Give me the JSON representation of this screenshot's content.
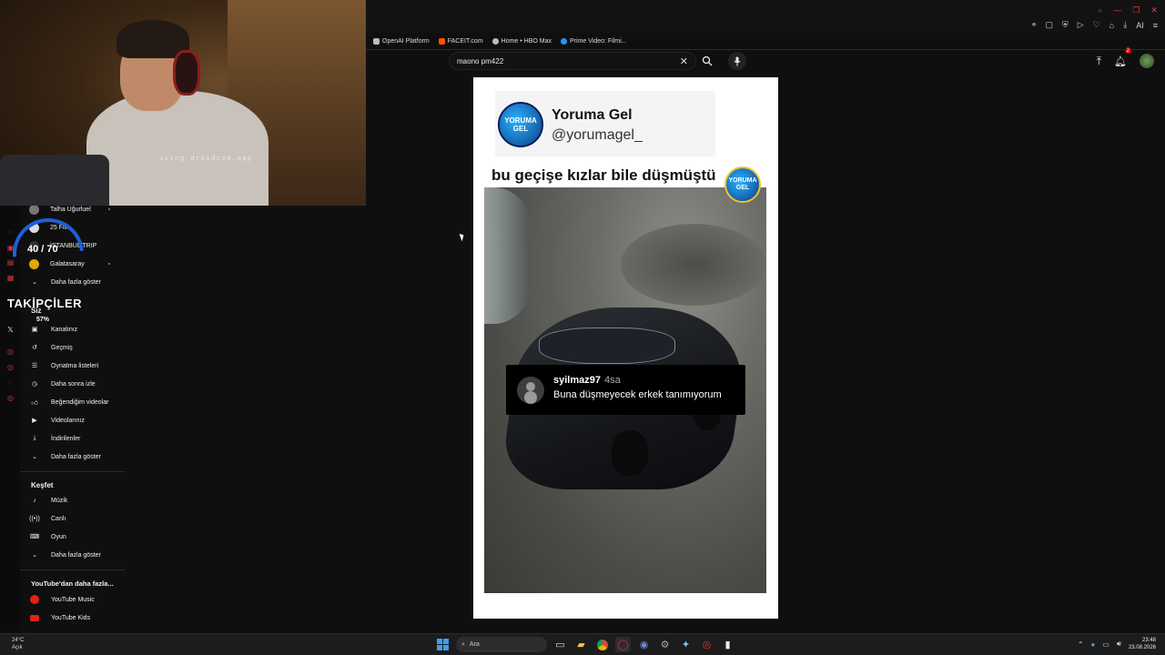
{
  "webcam": {
    "caption": "using droidcam.app"
  },
  "bookmarks": [
    "OpenAI Platform",
    "FACEIT.com",
    "Home • HBO Max",
    "Prime Video: Filmi..."
  ],
  "search": {
    "query": "maono pm422"
  },
  "header": {
    "notifications": "2",
    "ai_label": "AI"
  },
  "overlay": {
    "count": "40 / 70",
    "followers": "TAKİPÇİLER",
    "percent": "57%"
  },
  "sidebar": {
    "subscriptions": [
      {
        "label": "Talha Uğurluel"
      },
      {
        "label": "25 Film"
      },
      {
        "label": "İSTANBUL TRIP"
      },
      {
        "label": "Galatasaray"
      }
    ],
    "show_more": "Daha fazla göster",
    "you_title": "Siz",
    "you_items": [
      {
        "label": "Kanalınız"
      },
      {
        "label": "Geçmiş"
      },
      {
        "label": "Oynatma listeleri"
      },
      {
        "label": "Daha sonra izle"
      },
      {
        "label": "Beğendiğim videolar"
      },
      {
        "label": "Videolarınız"
      },
      {
        "label": "İndirilenler"
      },
      {
        "label": "Daha fazla göster"
      }
    ],
    "explore_title": "Keşfet",
    "explore_items": [
      {
        "label": "Müzik"
      },
      {
        "label": "Canlı"
      },
      {
        "label": "Oyun"
      },
      {
        "label": "Daha fazla göster"
      }
    ],
    "more_title": "YouTube'dan daha fazla...",
    "more_items": [
      {
        "label": "YouTube Music"
      },
      {
        "label": "YouTube Kids"
      }
    ]
  },
  "short": {
    "channel_name": "Yoruma Gel",
    "channel_handle": "@yorumagel_",
    "logo_text": "YORUMA GEL",
    "title": "bu geçişe kızlar bile düşmüştü",
    "comment_user": "syilmaz97",
    "comment_time": "4sa",
    "comment_text": "Buna düşmeyecek erkek tanımıyorum"
  },
  "taskbar": {
    "temperature": "24°C",
    "weather": "Açık",
    "search_placeholder": "Ara",
    "time": "23:48",
    "date": "23.08.2026"
  }
}
